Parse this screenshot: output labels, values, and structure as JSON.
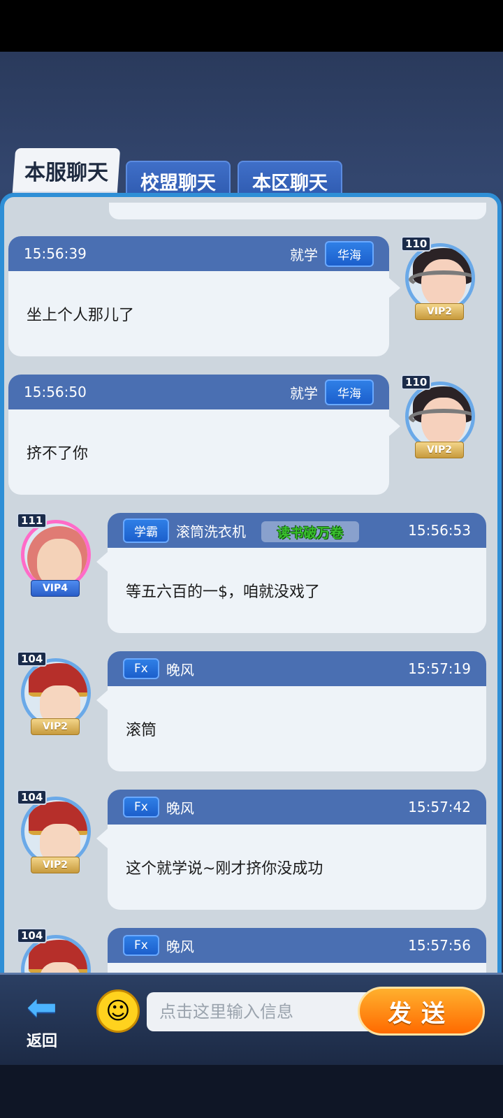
{
  "tabs": [
    {
      "label": "本服聊天",
      "active": true
    },
    {
      "label": "校盟聊天",
      "active": false
    },
    {
      "label": "本区聊天",
      "active": false
    }
  ],
  "messages": [
    {
      "side": "right",
      "time": "15:56:39",
      "name": "就学",
      "badge": "华海",
      "text": "坐上个人那儿了",
      "level": "110",
      "vip": "VIP2"
    },
    {
      "side": "right",
      "time": "15:56:50",
      "name": "就学",
      "badge": "华海",
      "text": "挤不了你",
      "level": "110",
      "vip": "VIP2"
    },
    {
      "side": "left",
      "time": "15:56:53",
      "name": "滚筒洗衣机",
      "badge": "学霸",
      "sticker": "读书破万卷",
      "text": "等五六百的一$，咱就没戏了",
      "level": "111",
      "vip": "VIP4"
    },
    {
      "side": "left",
      "time": "15:57:19",
      "name": "晚风",
      "badge": "Fx",
      "text": "滚筒",
      "level": "104",
      "vip": "VIP2"
    },
    {
      "side": "left",
      "time": "15:57:42",
      "name": "晚风",
      "badge": "Fx",
      "text": "这个就学说~刚才挤你没成功",
      "level": "104",
      "vip": "VIP2"
    },
    {
      "side": "left",
      "time": "15:57:56",
      "name": "晚风",
      "badge": "Fx",
      "text": "",
      "level": "104",
      "vip": ""
    }
  ],
  "bottom": {
    "back_label": "返回",
    "input_placeholder": "点击这里输入信息",
    "send_label": "发送"
  },
  "icons": {
    "back": "back-arrow-icon",
    "emoji": "smiley-emoji-icon"
  }
}
